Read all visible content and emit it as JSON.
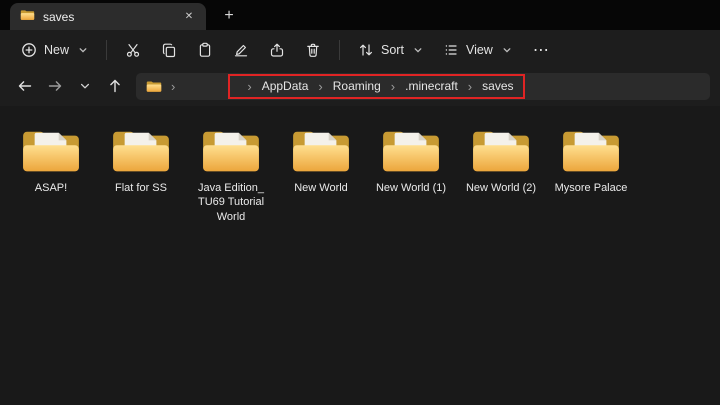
{
  "tab": {
    "title": "saves"
  },
  "toolbar": {
    "new_label": "New",
    "sort_label": "Sort",
    "view_label": "View"
  },
  "icons": {
    "separator": "›",
    "more": "⋯",
    "close": "✕",
    "new_tab": "+"
  },
  "breadcrumb": {
    "items": [
      "AppData",
      "Roaming",
      ".minecraft",
      "saves"
    ]
  },
  "annotation": {
    "color": "#e02424"
  },
  "folders": [
    "ASAP!",
    "Flat for SS",
    "Java Edition_ TU69 Tutorial World",
    "New World",
    "New World (1)",
    "New World (2)",
    "Mysore Palace"
  ]
}
